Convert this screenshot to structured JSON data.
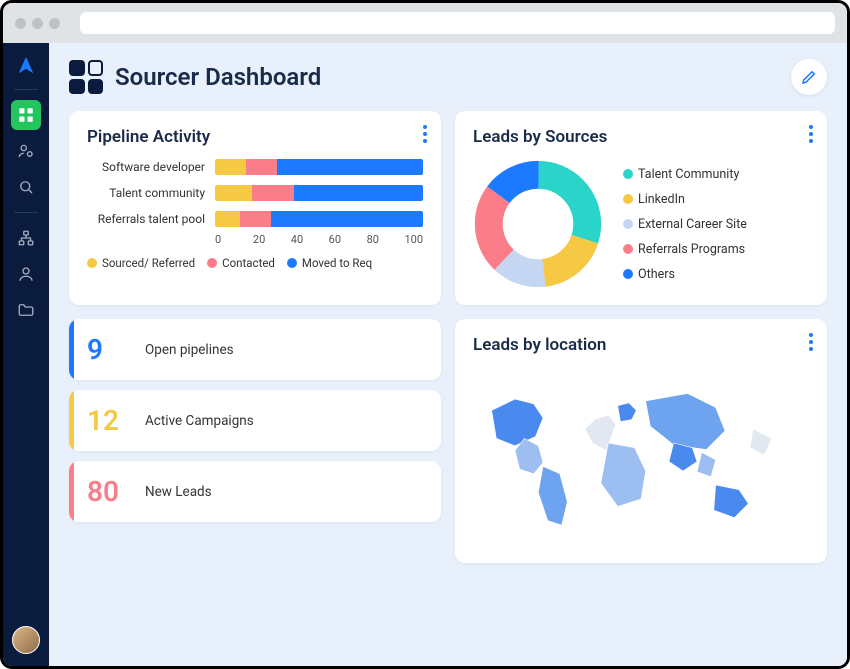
{
  "header": {
    "title": "Sourcer Dashboard"
  },
  "pipeline": {
    "title": "Pipeline Activity",
    "rows": [
      {
        "label": "Software developer"
      },
      {
        "label": "Talent community"
      },
      {
        "label": "Referrals talent pool"
      }
    ],
    "axis": [
      "0",
      "20",
      "40",
      "60",
      "80",
      "100"
    ],
    "legend": [
      {
        "label": "Sourced/ Referred"
      },
      {
        "label": "Contacted"
      },
      {
        "label": "Moved to Req"
      }
    ]
  },
  "sources": {
    "title": "Leads by Sources",
    "legend": [
      {
        "label": "Talent Community"
      },
      {
        "label": "LinkedIn"
      },
      {
        "label": "External Career Site"
      },
      {
        "label": "Referrals Programs"
      },
      {
        "label": "Others"
      }
    ]
  },
  "stats": [
    {
      "value": "9",
      "label": "Open pipelines"
    },
    {
      "value": "12",
      "label": "Active Campaigns"
    },
    {
      "value": "80",
      "label": "New Leads"
    }
  ],
  "location": {
    "title": "Leads by location"
  },
  "chart_data": [
    {
      "type": "bar",
      "title": "Pipeline Activity",
      "orientation": "horizontal-stacked",
      "categories": [
        "Software developer",
        "Talent community",
        "Referrals talent pool"
      ],
      "series": [
        {
          "name": "Sourced/ Referred",
          "values": [
            15,
            18,
            12
          ],
          "color": "#f6c945"
        },
        {
          "name": "Contacted",
          "values": [
            15,
            20,
            15
          ],
          "color": "#fb7d8a"
        },
        {
          "name": "Moved to Req",
          "values": [
            70,
            62,
            73
          ],
          "color": "#1b7aff"
        }
      ],
      "xlabel": "",
      "ylabel": "",
      "xlim": [
        0,
        100
      ]
    },
    {
      "type": "pie",
      "title": "Leads by Sources",
      "style": "donut",
      "series": [
        {
          "name": "Talent Community",
          "value": 30,
          "color": "#2bd4c9"
        },
        {
          "name": "LinkedIn",
          "value": 18,
          "color": "#f6c945"
        },
        {
          "name": "External Career Site",
          "value": 14,
          "color": "#c5d6f2"
        },
        {
          "name": "Referrals Programs",
          "value": 23,
          "color": "#fb7d8a"
        },
        {
          "name": "Others",
          "value": 15,
          "color": "#1b7aff"
        }
      ]
    },
    {
      "type": "map",
      "title": "Leads by location",
      "projection": "world",
      "note": "Choropleth world map; darker blue = higher lead density. Exact per-country values not labeled in source."
    }
  ]
}
